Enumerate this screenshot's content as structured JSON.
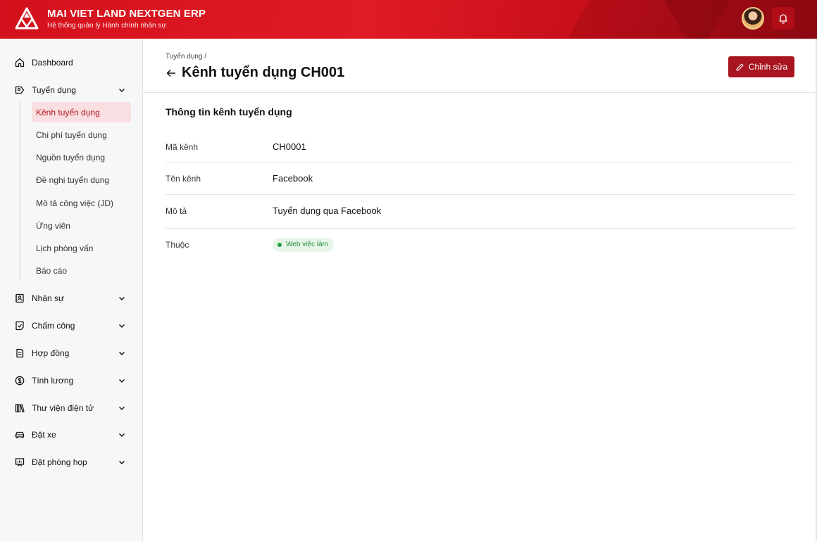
{
  "header": {
    "brand_title": "MAI VIET LAND NEXTGEN ERP",
    "brand_subtitle": "Hệ thống quản lý Hành chính nhân sự",
    "colors": {
      "primary": "#d3111c",
      "dark": "#9c0a14"
    },
    "icons": {
      "logo": "mai-viet-land-logo",
      "notifications": "bell-icon",
      "avatar": "user-avatar"
    }
  },
  "sidebar": {
    "items": [
      {
        "label": "Dashboard",
        "icon": "home-icon"
      },
      {
        "label": "Tuyển dụng",
        "icon": "recruit-icon",
        "expanded": true
      },
      {
        "label": "Nhân sự",
        "icon": "contact-card-icon"
      },
      {
        "label": "Chấm công",
        "icon": "timesheet-icon"
      },
      {
        "label": "Hợp đồng",
        "icon": "document-icon"
      },
      {
        "label": "Tính lương",
        "icon": "dollar-icon"
      },
      {
        "label": "Thư viện điện tử",
        "icon": "library-icon"
      },
      {
        "label": "Đặt xe",
        "icon": "car-icon"
      },
      {
        "label": "Đặt phòng họp",
        "icon": "meeting-room-icon"
      }
    ],
    "sub_items": [
      {
        "label": "Kênh tuyển dụng",
        "active": true
      },
      {
        "label": "Chi phí tuyển dụng"
      },
      {
        "label": "Nguồn tuyển dụng"
      },
      {
        "label": "Đề nghị tuyển dụng"
      },
      {
        "label": "Mô tả công việc (JD)"
      },
      {
        "label": "Ứng viên"
      },
      {
        "label": "Lịch phỏng vấn"
      },
      {
        "label": "Báo cáo"
      }
    ],
    "active_color": "#f9dfe1"
  },
  "main": {
    "breadcrumb": "Tuyển dụng /",
    "title": "Kênh tuyển dụng CH001",
    "edit_label": "Chỉnh sửa",
    "section_title": "Thông tin kênh tuyển dụng",
    "fields": [
      {
        "label": "Mã kênh",
        "value": "CH0001"
      },
      {
        "label": "Tên kênh",
        "value": "Facebook"
      },
      {
        "label": "Mô tả",
        "value": "Tuyển dụng qua Facebook"
      },
      {
        "label": "Thuộc",
        "value": "Web việc làm",
        "type": "badge",
        "color": "#22a046"
      }
    ]
  }
}
